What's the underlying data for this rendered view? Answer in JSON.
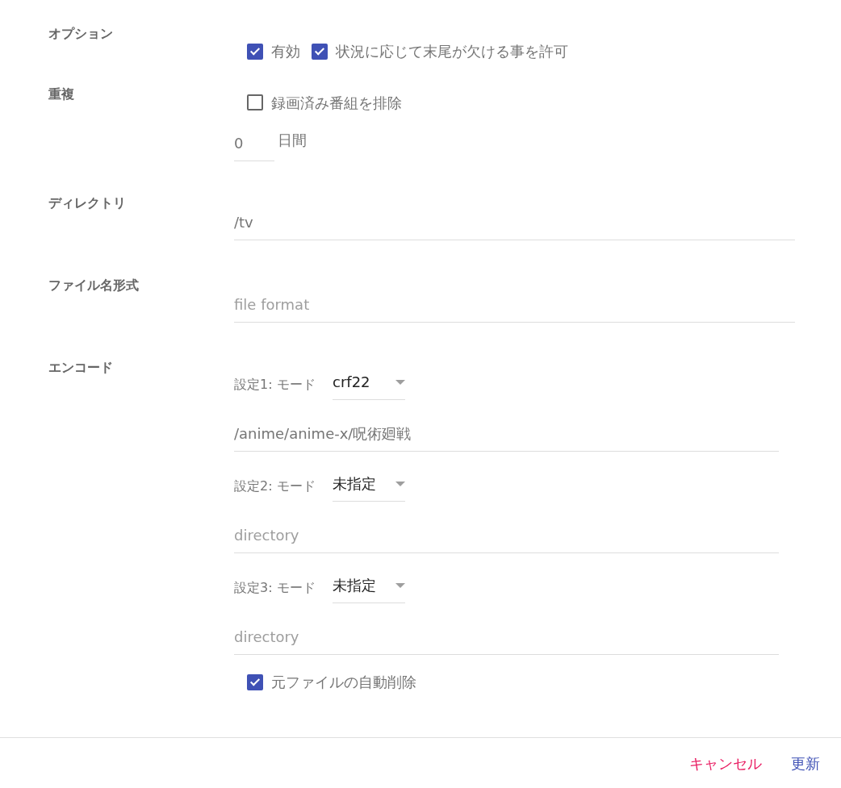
{
  "sections": [
    {
      "label": "オプション",
      "kind": "options",
      "checkboxes": [
        {
          "label": "有効",
          "checked": true
        },
        {
          "label": "状況に応じて末尾が欠ける事を許可",
          "checked": true
        }
      ]
    },
    {
      "label": "重複",
      "kind": "duplicate",
      "checkbox": {
        "label": "録画済み番組を排除",
        "checked": false
      },
      "days": {
        "value": "0",
        "unit": "日間"
      }
    },
    {
      "label": "ディレクトリ",
      "kind": "text",
      "field": {
        "value": "/tv"
      }
    },
    {
      "label": "ファイル名形式",
      "kind": "text",
      "field": {
        "placeholder": "file format"
      }
    },
    {
      "label": "エンコード",
      "kind": "encode",
      "settings": [
        {
          "label": "設定1: モード",
          "mode": "crf22",
          "directory": {
            "value": "/anime/anime-x/呪術廻戦"
          }
        },
        {
          "label": "設定2: モード",
          "mode": "未指定",
          "directory": {
            "placeholder": "directory"
          }
        },
        {
          "label": "設定3: モード",
          "mode": "未指定",
          "directory": {
            "placeholder": "directory"
          }
        }
      ],
      "checkbox": {
        "label": "元ファイルの自動削除",
        "checked": true
      }
    }
  ],
  "actions": [
    {
      "label": "キャンセル",
      "kind": "cancel"
    },
    {
      "label": "更新",
      "kind": "submit"
    }
  ]
}
